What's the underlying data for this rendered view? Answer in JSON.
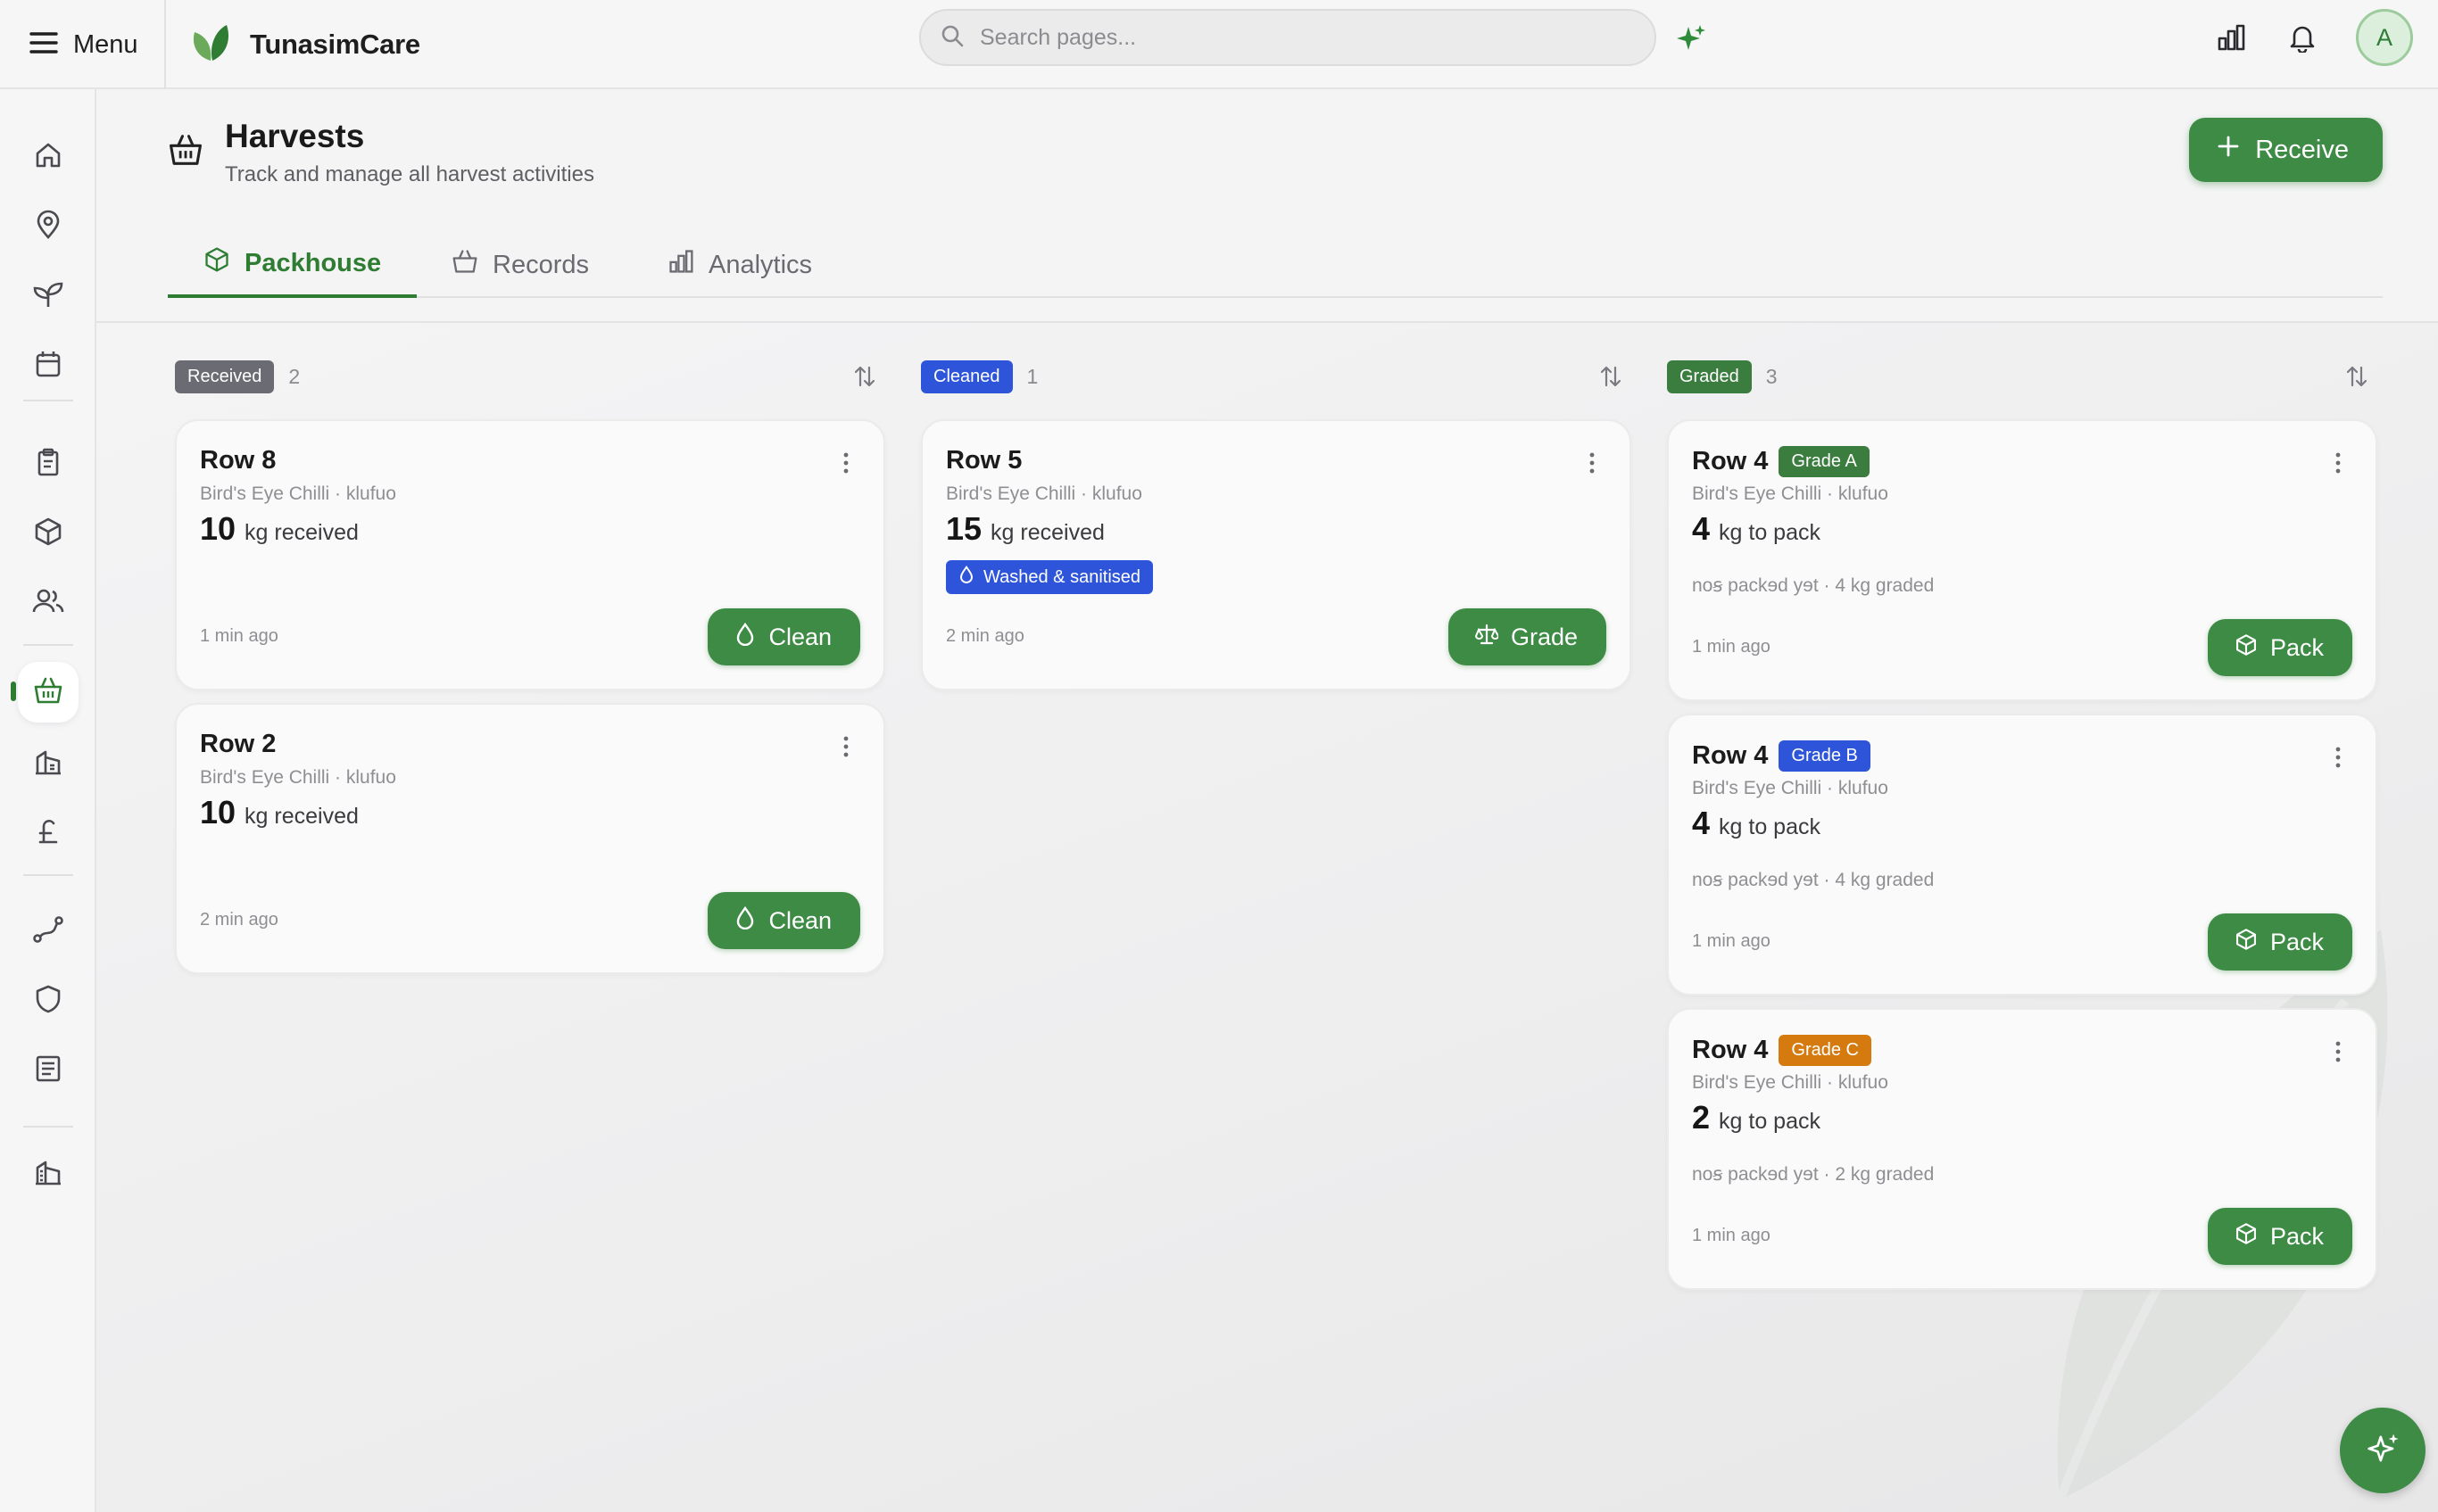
{
  "app": {
    "name": "TunasimCare",
    "menu_label": "Menu"
  },
  "search": {
    "placeholder": "Search pages..."
  },
  "user": {
    "initial": "A"
  },
  "colors": {
    "brand_green": "#3d8b45",
    "received": "#6b6b73",
    "cleaned": "#2e55d9",
    "graded": "#3a7d3f",
    "grade_a": "#3a7d3f",
    "grade_b": "#2e55d9",
    "grade_c": "#d47a0f"
  },
  "sidebar": {
    "items": [
      {
        "icon": "home-icon"
      },
      {
        "icon": "map-pin-icon"
      },
      {
        "icon": "sprout-icon"
      },
      {
        "icon": "calendar-icon"
      },
      {
        "icon": "clipboard-icon"
      },
      {
        "icon": "package-icon"
      },
      {
        "icon": "users-icon"
      },
      {
        "icon": "harvest-basket-icon",
        "active": true
      },
      {
        "icon": "building-icon"
      },
      {
        "icon": "pound-icon"
      },
      {
        "icon": "route-icon"
      },
      {
        "icon": "shield-icon"
      },
      {
        "icon": "document-icon"
      },
      {
        "icon": "office-building-icon"
      }
    ]
  },
  "page": {
    "title": "Harvests",
    "subtitle": "Track and manage all harvest activities",
    "receive_label": "Receive",
    "tabs": [
      {
        "label": "Packhouse",
        "icon": "package-icon",
        "active": true
      },
      {
        "label": "Records",
        "icon": "basket-icon",
        "active": false
      },
      {
        "label": "Analytics",
        "icon": "bar-chart-icon",
        "active": false
      }
    ]
  },
  "board": {
    "columns": [
      {
        "status": "Received",
        "count": "2",
        "cards": [
          {
            "title": "Row 8",
            "crop": "Bird's Eye Chilli · klufuo",
            "qty": "10",
            "unit": "kg received",
            "time": "1 min ago",
            "action": "Clean"
          },
          {
            "title": "Row 2",
            "crop": "Bird's Eye Chilli · klufuo",
            "qty": "10",
            "unit": "kg received",
            "time": "2 min ago",
            "action": "Clean"
          }
        ]
      },
      {
        "status": "Cleaned",
        "count": "1",
        "cards": [
          {
            "title": "Row 5",
            "crop": "Bird's Eye Chilli · klufuo",
            "qty": "15",
            "unit": "kg received",
            "chip": "Washed & sanitised",
            "time": "2 min ago",
            "action": "Grade"
          }
        ]
      },
      {
        "status": "Graded",
        "count": "3",
        "cards": [
          {
            "title": "Row 4",
            "grade": "Grade A",
            "crop": "Bird's Eye Chilli · klufuo",
            "qty": "4",
            "unit": "kg to pack",
            "note": "noꞩ packɘd yɘt · 4 kg graded",
            "time": "1 min ago",
            "action": "Pack"
          },
          {
            "title": "Row 4",
            "grade": "Grade B",
            "crop": "Bird's Eye Chilli · klufuo",
            "qty": "4",
            "unit": "kg to pack",
            "note": "noꞩ packɘd yɘt · 4 kg graded",
            "time": "1 min ago",
            "action": "Pack"
          },
          {
            "title": "Row 4",
            "grade": "Grade C",
            "crop": "Bird's Eye Chilli · klufuo",
            "qty": "2",
            "unit": "kg to pack",
            "note": "noꞩ packɘd yɘt · 2 kg graded",
            "time": "1 min ago",
            "action": "Pack"
          }
        ]
      }
    ]
  }
}
